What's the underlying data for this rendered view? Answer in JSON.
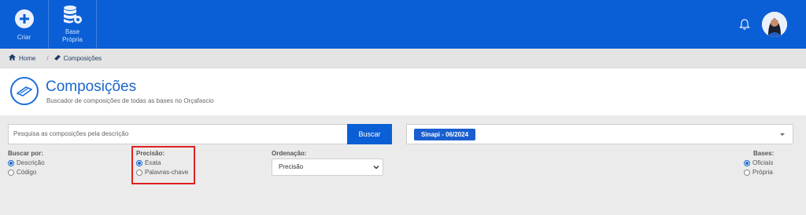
{
  "topbar": {
    "create_label": "Criar",
    "base_label_line1": "Base",
    "base_label_line2": "Própria",
    "accent_color": "#0b5fd6"
  },
  "breadcrumb": {
    "home": "Home",
    "separator": "/",
    "current": "Composições"
  },
  "header": {
    "title": "Composições",
    "subtitle": "Buscador de composições de todas as bases no Orçafascio"
  },
  "search": {
    "placeholder": "Pesquisa as composições pela descrição",
    "button_label": "Buscar"
  },
  "base_select": {
    "selected_tag": "Sinapi - 06/2024"
  },
  "filters": {
    "search_by": {
      "label": "Buscar por:",
      "options": [
        "Descrição",
        "Código"
      ],
      "selected": "Descrição"
    },
    "precision": {
      "label": "Precisão:",
      "options": [
        "Exata",
        "Palavras-chave"
      ],
      "selected": "Exata"
    },
    "ordering": {
      "label": "Ordenação:",
      "selected": "Precisão"
    },
    "bases": {
      "label": "Bases:",
      "options": [
        "Oficiais",
        "Própria"
      ],
      "selected": "Oficiais"
    }
  },
  "icons": {
    "create": "plus-circle-icon",
    "base": "database-gear-icon",
    "notifications": "bell-icon",
    "home": "home-icon",
    "compositions": "trowel-icon"
  }
}
